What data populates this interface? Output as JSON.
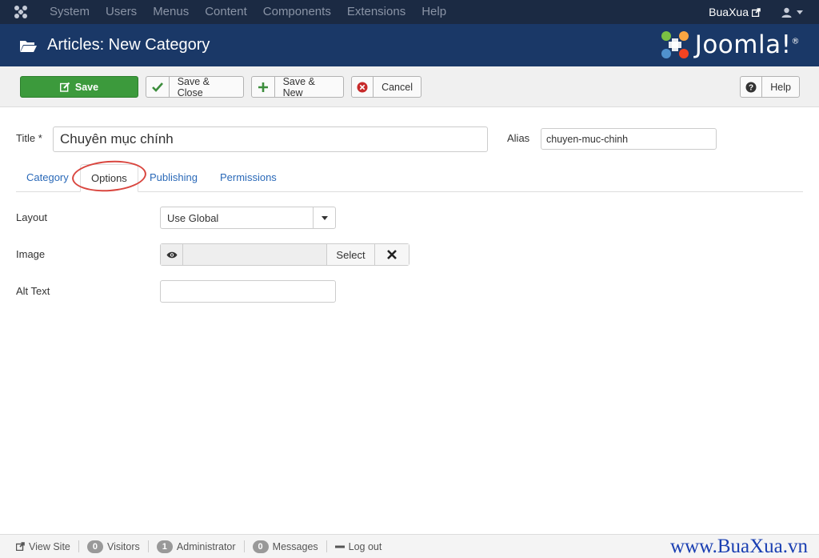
{
  "topnav": {
    "menu": [
      "System",
      "Users",
      "Menus",
      "Content",
      "Components",
      "Extensions",
      "Help"
    ],
    "site_name": "BuaXua",
    "icons": {
      "logo": "joomla-icon",
      "external": "external-link-icon",
      "user": "user-icon",
      "caret": "caret-down-icon"
    }
  },
  "header": {
    "title": "Articles: New Category",
    "brand": "Joomla!",
    "brand_mark": "®"
  },
  "toolbar": {
    "save": "Save",
    "save_close": "Save & Close",
    "save_new": "Save & New",
    "cancel": "Cancel",
    "help": "Help"
  },
  "form": {
    "title_label": "Title *",
    "title_value": "Chuyên mục chính",
    "alias_label": "Alias",
    "alias_value": "chuyen-muc-chinh",
    "tabs": [
      "Category",
      "Options",
      "Publishing",
      "Permissions"
    ],
    "active_tab": "Options",
    "layout_label": "Layout",
    "layout_value": "Use Global",
    "image_label": "Image",
    "image_select": "Select",
    "alt_label": "Alt Text",
    "alt_value": ""
  },
  "statusbar": {
    "view_site": "View Site",
    "visitors_count": "0",
    "visitors": "Visitors",
    "admin_count": "1",
    "admin": "Administrator",
    "messages_count": "0",
    "messages": "Messages",
    "logout": "Log out",
    "watermark": "www.BuaXua.vn"
  },
  "colors": {
    "navbar": "#1b2a43",
    "header": "#1a3867",
    "save_button": "#3c9a3c",
    "link": "#2a69b8",
    "highlight_circle": "#d9463f"
  }
}
